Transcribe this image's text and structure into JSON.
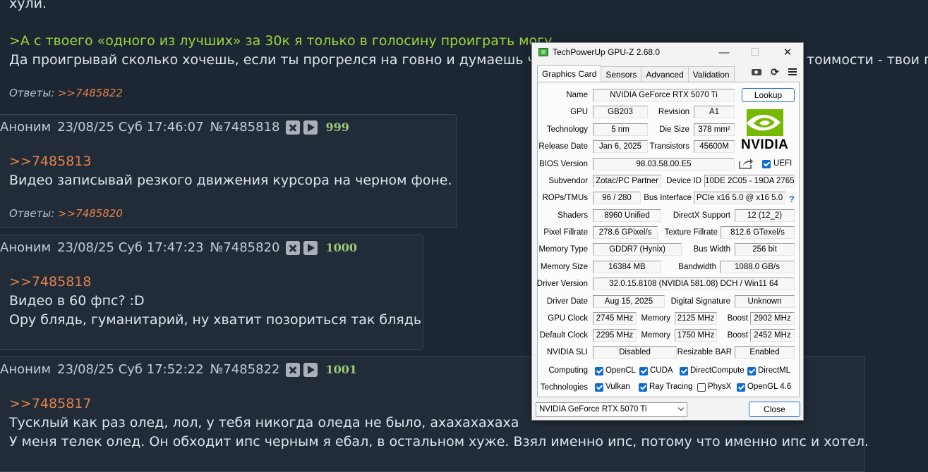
{
  "forum": {
    "top_text": "хули.",
    "quote_text": ">А с твоего «одного из лучших» за 30к я только в голосину проиграть могу",
    "body_text": "Да проигрывай сколько хочешь, если ты прогрелся на говно и думаешь что",
    "body_text_right": "тоимости - твои пр",
    "replies_label": "Ответы:",
    "replies_1": ">>7485822",
    "posts": [
      {
        "author": "Аноним",
        "date": "23/08/25 Суб 17:46:07",
        "number": "№7485818",
        "count": "999",
        "reply_to": ">>7485813",
        "lines": [
          "Видео записывай резкого движения курсора на черном фоне."
        ],
        "replies_label": "Ответы:",
        "replies": ">>7485820"
      },
      {
        "author": "Аноним",
        "date": "23/08/25 Суб 17:47:23",
        "number": "№7485820",
        "count": "1000",
        "reply_to": ">>7485818",
        "lines": [
          "Видео в 60 фпс? :D",
          "Ору блядь, гуманитарий, ну хватит позориться так блядь"
        ]
      },
      {
        "author": "Аноним",
        "date": "23/08/25 Суб 17:52:22",
        "number": "№7485822",
        "count": "1001",
        "reply_to": ">>7485817",
        "lines": [
          "Тусклый как раз олед, лол, у тебя никогда оледа не было, ахахахахаха",
          "У меня телек олед. Он обходит ипс черным я ебал, в остальном хуже. Взял именно ипс, потому что именно ипс и хотел."
        ]
      }
    ]
  },
  "gpuz": {
    "title": "TechPowerUp GPU-Z 2.68.0",
    "window_controls": {
      "minimize": "—",
      "maximize": "☐",
      "close": "✕"
    },
    "tabs": [
      "Graphics Card",
      "Sensors",
      "Advanced",
      "Validation"
    ],
    "toolbar_icons": [
      "camera-icon",
      "refresh-icon",
      "menu-icon"
    ],
    "lookup_label": "Lookup",
    "logo_text": "NVIDIA",
    "labels": {
      "name": "Name",
      "gpu": "GPU",
      "revision": "Revision",
      "technology": "Technology",
      "die_size": "Die Size",
      "release_date": "Release Date",
      "transistors": "Transistors",
      "bios_version": "BIOS Version",
      "uefi": "UEFI",
      "subvendor": "Subvendor",
      "device_id": "Device ID",
      "rops_tmus": "ROPs/TMUs",
      "bus_interface": "Bus Interface",
      "shaders": "Shaders",
      "directx_support": "DirectX Support",
      "pixel_fillrate": "Pixel Fillrate",
      "texture_fillrate": "Texture Fillrate",
      "memory_type": "Memory Type",
      "bus_width": "Bus Width",
      "memory_size": "Memory Size",
      "bandwidth": "Bandwidth",
      "driver_version": "Driver Version",
      "driver_date": "Driver Date",
      "digital_signature": "Digital Signature",
      "gpu_clock": "GPU Clock",
      "memory": "Memory",
      "boost": "Boost",
      "default_clock": "Default Clock",
      "nvidia_sli": "NVIDIA SLI",
      "resizable_bar": "Resizable BAR",
      "computing": "Computing",
      "technologies": "Technologies"
    },
    "values": {
      "name": "NVIDIA GeForce RTX 5070 Ti",
      "gpu": "GB203",
      "revision": "A1",
      "technology": "5 nm",
      "die_size": "378 mm²",
      "release_date": "Jan 6, 2025",
      "transistors": "45600M",
      "bios_version": "98.03.58.00.E5",
      "subvendor": "Zotac/PC Partner",
      "device_id": "10DE 2C05 - 19DA 2765",
      "rops_tmus": "96 / 280",
      "bus_interface": "PCIe x16 5.0 @ x16 5.0",
      "shaders": "8960 Unified",
      "directx_support": "12 (12_2)",
      "pixel_fillrate": "278.6 GPixel/s",
      "texture_fillrate": "812.6 GTexel/s",
      "memory_type": "GDDR7 (Hynix)",
      "bus_width": "256 bit",
      "memory_size": "16384 MB",
      "bandwidth": "1088.0 GB/s",
      "driver_version": "32.0.15.8108 (NVIDIA 581.08) DCH / Win11 64",
      "driver_date": "Aug 15, 2025",
      "digital_signature": "Unknown",
      "gpu_clock": "2745 MHz",
      "gpu_memory": "2125 MHz",
      "gpu_boost": "2902 MHz",
      "default_clock": "2295 MHz",
      "default_memory": "1750 MHz",
      "default_boost": "2452 MHz",
      "nvidia_sli": "Disabled",
      "resizable_bar": "Enabled"
    },
    "computing": [
      {
        "label": "OpenCL",
        "checked": true
      },
      {
        "label": "CUDA",
        "checked": true
      },
      {
        "label": "DirectCompute",
        "checked": true
      },
      {
        "label": "DirectML",
        "checked": true
      }
    ],
    "technologies": [
      {
        "label": "Vulkan",
        "checked": true
      },
      {
        "label": "Ray Tracing",
        "checked": true
      },
      {
        "label": "PhysX",
        "checked": false
      },
      {
        "label": "OpenGL 4.6",
        "checked": true
      }
    ],
    "uefi_checked": true,
    "help_mark": "?",
    "gpu_select": "NVIDIA GeForce RTX 5070 Ti",
    "close_label": "Close",
    "logo_color": "#76b900"
  }
}
